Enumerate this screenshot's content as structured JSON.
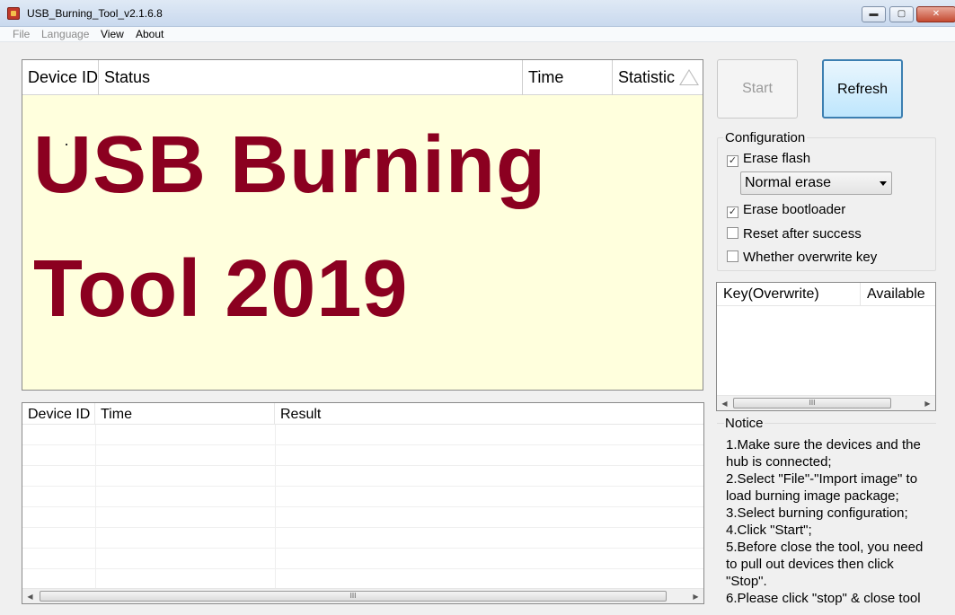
{
  "window": {
    "title": "USB_Burning_Tool_v2.1.6.8",
    "minimize": "▬",
    "maximize": "▢",
    "close": "✕"
  },
  "menu": [
    "File",
    "Language",
    "View",
    "About"
  ],
  "device_list": {
    "columns": [
      "Device ID",
      "Status",
      "Time",
      "Statistic"
    ],
    "banner_line1": "USB Burning",
    "banner_line2": "Tool 2019",
    "banner_color": "#8b0020"
  },
  "buttons": {
    "start": "Start",
    "refresh": "Refresh"
  },
  "configuration": {
    "title": "Configuration",
    "erase_flash": {
      "label": "Erase flash",
      "checked": true
    },
    "erase_mode": "Normal erase",
    "erase_bootloader": {
      "label": "Erase bootloader",
      "checked": true
    },
    "reset_after_success": {
      "label": "Reset after success",
      "checked": false
    },
    "overwrite_key": {
      "label": "Whether overwrite key",
      "checked": false
    }
  },
  "key_list": {
    "columns": [
      "Key(Overwrite)",
      "Available"
    ]
  },
  "notice": {
    "title": "Notice",
    "text": "1.Make sure the devices and the hub is connected;\n2.Select \"File\"-\"Import image\" to load burning image package;\n3.Select burning configuration;\n4.Click \"Start\";\n5.Before close the tool, you need to pull out devices then click \"Stop\".\n6.Please click \"stop\" & close tool"
  },
  "result_list": {
    "columns": [
      "Device ID",
      "Time",
      "Result"
    ]
  },
  "scroll": {
    "left": "◀",
    "right": "▶",
    "grip": "III"
  },
  "check_mark": "✓"
}
